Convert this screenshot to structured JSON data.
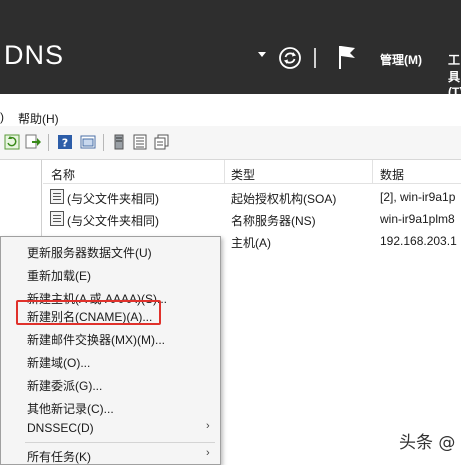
{
  "titlebar": {
    "title": "DNS",
    "menus": [
      "管理(M)",
      "工具(T)"
    ]
  },
  "menubar": {
    "items": [
      ")",
      "帮助(H)"
    ]
  },
  "list": {
    "columns": [
      "名称",
      "类型",
      "数据"
    ],
    "rows": [
      {
        "name": "(与父文件夹相同)",
        "type": "起始授权机构(SOA)",
        "data": "[2], win-ir9a1p"
      },
      {
        "name": "(与父文件夹相同)",
        "type": "名称服务器(NS)",
        "data": "win-ir9a1plm8"
      },
      {
        "name": "",
        "type": "主机(A)",
        "data": "192.168.203.1"
      }
    ]
  },
  "context_menu": {
    "items": [
      {
        "label": "更新服务器数据文件(U)",
        "submenu": false
      },
      {
        "label": "重新加载(E)",
        "submenu": false
      },
      {
        "label": "新建主机(A 或 AAAA)(S)...",
        "submenu": false
      },
      {
        "label": "新建别名(CNAME)(A)...",
        "submenu": false,
        "highlighted": true
      },
      {
        "label": "新建邮件交换器(MX)(M)...",
        "submenu": false
      },
      {
        "label": "新建域(O)...",
        "submenu": false
      },
      {
        "label": "新建委派(G)...",
        "submenu": false
      },
      {
        "label": "其他新记录(C)...",
        "submenu": false
      },
      {
        "label": "DNSSEC(D)",
        "submenu": true
      },
      {
        "label": "所有任务(K)",
        "submenu": true
      }
    ],
    "submenu_arrow": "›"
  },
  "watermark": "头条 @",
  "colors": {
    "titlebar_bg": "#2e2e2e",
    "highlight_border": "#e0312b",
    "menu_bg": "#f5f5f5"
  },
  "icons": [
    "dropdown-arrow-icon",
    "refresh-icon",
    "flag-icon",
    "refresh-tool-icon",
    "export-icon",
    "help-icon",
    "properties-icon",
    "server-icon",
    "list-icon",
    "copy-icon",
    "record-icon"
  ]
}
